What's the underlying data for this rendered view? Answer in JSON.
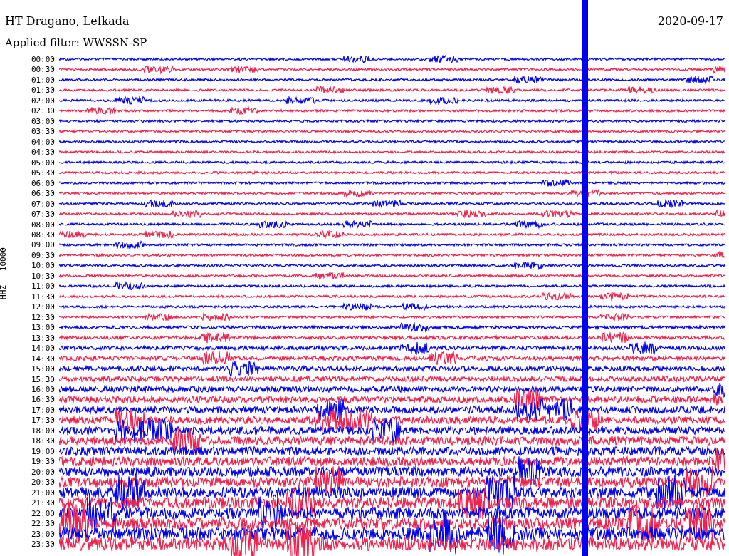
{
  "header": {
    "station": "HT Dragano, Lefkada",
    "date": "2020-09-17",
    "filter": "Applied filter: WWSSN-SP"
  },
  "axis_label": "HHZ - 10000",
  "rows": [
    {
      "time": "00:00",
      "color": "#0000f0"
    },
    {
      "time": "00:30",
      "color": "#f0204c"
    },
    {
      "time": "01:00",
      "color": "#0000f0"
    },
    {
      "time": "01:30",
      "color": "#f0204c"
    },
    {
      "time": "02:00",
      "color": "#0000f0"
    },
    {
      "time": "02:30",
      "color": "#f0204c"
    },
    {
      "time": "03:00",
      "color": "#0000f0"
    },
    {
      "time": "03:30",
      "color": "#f0204c"
    },
    {
      "time": "04:00",
      "color": "#0000f0"
    },
    {
      "time": "04:30",
      "color": "#f0204c"
    },
    {
      "time": "05:00",
      "color": "#0000f0"
    },
    {
      "time": "05:30",
      "color": "#f0204c"
    },
    {
      "time": "06:00",
      "color": "#0000f0"
    },
    {
      "time": "06:30",
      "color": "#f0204c"
    },
    {
      "time": "07:00",
      "color": "#0000f0"
    },
    {
      "time": "07:30",
      "color": "#f0204c"
    },
    {
      "time": "08:00",
      "color": "#0000f0"
    },
    {
      "time": "08:30",
      "color": "#f0204c"
    },
    {
      "time": "09:00",
      "color": "#0000f0"
    },
    {
      "time": "09:30",
      "color": "#f0204c"
    },
    {
      "time": "10:00",
      "color": "#0000f0"
    },
    {
      "time": "10:30",
      "color": "#f0204c"
    },
    {
      "time": "11:00",
      "color": "#0000f0"
    },
    {
      "time": "11:30",
      "color": "#f0204c"
    },
    {
      "time": "12:00",
      "color": "#0000f0"
    },
    {
      "time": "12:30",
      "color": "#f0204c"
    },
    {
      "time": "13:00",
      "color": "#0000f0"
    },
    {
      "time": "13:30",
      "color": "#f0204c"
    },
    {
      "time": "14:00",
      "color": "#0000f0"
    },
    {
      "time": "14:30",
      "color": "#f0204c"
    },
    {
      "time": "15:00",
      "color": "#0000f0"
    },
    {
      "time": "15:30",
      "color": "#f0204c"
    },
    {
      "time": "16:00",
      "color": "#0000f0"
    },
    {
      "time": "16:30",
      "color": "#f0204c"
    },
    {
      "time": "17:00",
      "color": "#0000f0"
    },
    {
      "time": "17:30",
      "color": "#f0204c"
    },
    {
      "time": "18:00",
      "color": "#0000f0"
    },
    {
      "time": "18:30",
      "color": "#f0204c"
    },
    {
      "time": "19:00",
      "color": "#0000f0"
    },
    {
      "time": "19:30",
      "color": "#f0204c"
    },
    {
      "time": "20:00",
      "color": "#0000f0"
    },
    {
      "time": "20:30",
      "color": "#f0204c"
    },
    {
      "time": "21:00",
      "color": "#0000f0"
    },
    {
      "time": "21:30",
      "color": "#f0204c"
    },
    {
      "time": "22:00",
      "color": "#0000f0"
    },
    {
      "time": "22:30",
      "color": "#f0204c"
    },
    {
      "time": "23:00",
      "color": "#0000f0"
    },
    {
      "time": "23:30",
      "color": "#f0204c"
    }
  ]
}
